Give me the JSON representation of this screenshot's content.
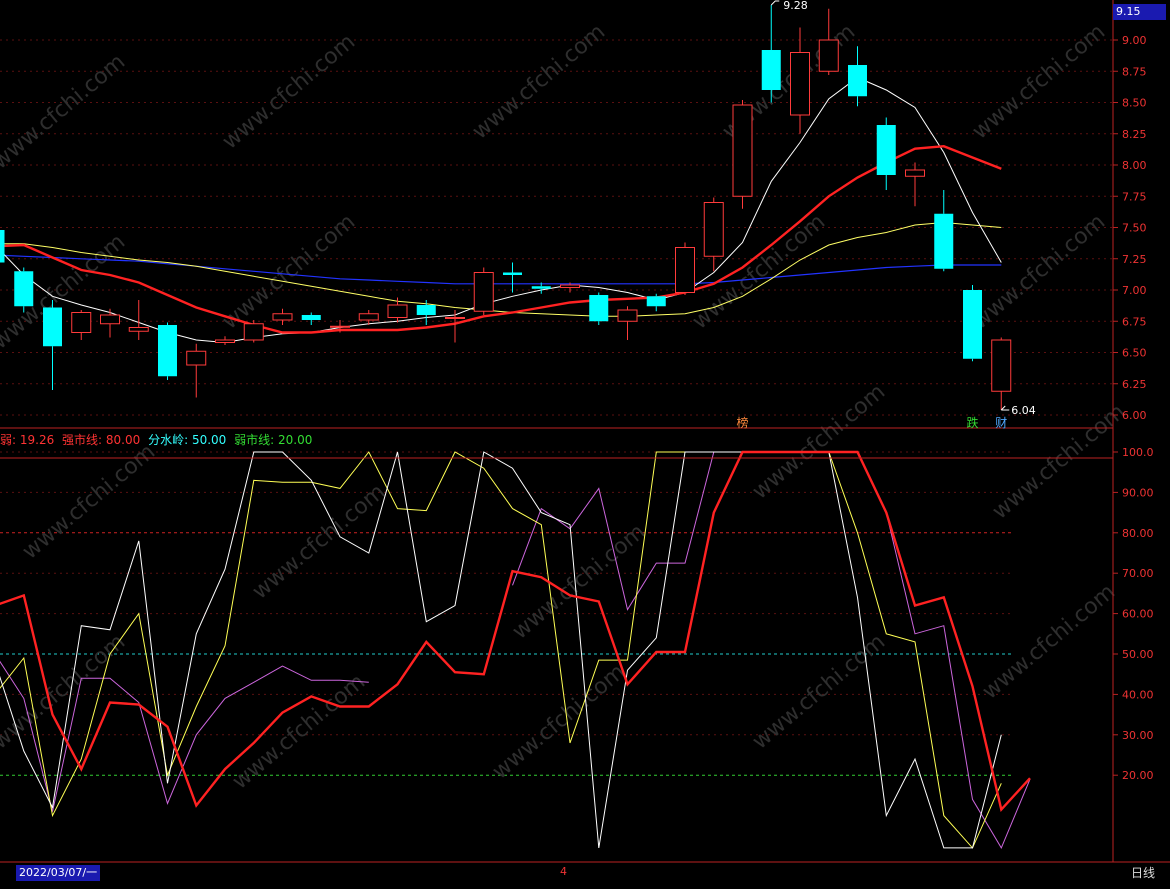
{
  "price_panel": {
    "current_price": "9.15",
    "high_label": "9.28",
    "low_label": "6.04",
    "y_axis_labels": [
      "9.00",
      "8.75",
      "8.50",
      "8.25",
      "8.00",
      "7.75",
      "7.50",
      "7.25",
      "7.00",
      "6.75",
      "6.50",
      "6.25",
      "6.00"
    ],
    "markers": [
      {
        "text": "榜",
        "color": "#ff8a3d"
      },
      {
        "text": "跌",
        "color": "#33dd33"
      },
      {
        "text": "财",
        "color": "#4fa8ff"
      }
    ]
  },
  "indicator_panel": {
    "legend": [
      {
        "text": "弱: 19.26",
        "color": "#ff3333"
      },
      {
        "text": "强市线: 80.00",
        "color": "#ff3333"
      },
      {
        "text": "分水岭: 50.00",
        "color": "#33ffff"
      },
      {
        "text": "弱市线: 20.00",
        "color": "#33dd33"
      }
    ],
    "y_axis_labels": [
      "100.0",
      "90.00",
      "80.00",
      "70.00",
      "60.00",
      "50.00",
      "40.00",
      "30.00",
      "20.00"
    ]
  },
  "footer": {
    "date": "2022/03/07/一",
    "tick_marker": "4",
    "period": "日线"
  },
  "watermark": "www.cfchi.com",
  "chart_data": {
    "type": "candlestick",
    "candles": [
      {
        "o": 7.48,
        "c": 7.22,
        "h": 7.52,
        "l": 7.2
      },
      {
        "o": 7.15,
        "c": 6.87,
        "h": 7.18,
        "l": 6.82
      },
      {
        "o": 6.86,
        "c": 6.55,
        "h": 6.92,
        "l": 6.2
      },
      {
        "o": 6.66,
        "c": 6.82,
        "h": 6.84,
        "l": 6.6
      },
      {
        "o": 6.73,
        "c": 6.8,
        "h": 6.85,
        "l": 6.62
      },
      {
        "o": 6.67,
        "c": 6.7,
        "h": 6.92,
        "l": 6.6
      },
      {
        "o": 6.72,
        "c": 6.31,
        "h": 6.74,
        "l": 6.28
      },
      {
        "o": 6.4,
        "c": 6.51,
        "h": 6.57,
        "l": 6.14
      },
      {
        "o": 6.58,
        "c": 6.6,
        "h": 6.63,
        "l": 6.56
      },
      {
        "o": 6.6,
        "c": 6.73,
        "h": 6.76,
        "l": 6.58
      },
      {
        "o": 6.76,
        "c": 6.81,
        "h": 6.85,
        "l": 6.72
      },
      {
        "o": 6.8,
        "c": 6.76,
        "h": 6.82,
        "l": 6.72
      },
      {
        "o": 6.71,
        "c": 6.71,
        "h": 6.76,
        "l": 6.66
      },
      {
        "o": 6.76,
        "c": 6.81,
        "h": 6.84,
        "l": 6.72
      },
      {
        "o": 6.78,
        "c": 6.88,
        "h": 6.94,
        "l": 6.74
      },
      {
        "o": 6.88,
        "c": 6.8,
        "h": 6.92,
        "l": 6.72
      },
      {
        "o": 6.78,
        "c": 6.78,
        "h": 6.84,
        "l": 6.58
      },
      {
        "o": 6.83,
        "c": 7.14,
        "h": 7.18,
        "l": 6.8
      },
      {
        "o": 7.14,
        "c": 7.12,
        "h": 7.22,
        "l": 6.98
      },
      {
        "o": 7.03,
        "c": 7.01,
        "h": 7.06,
        "l": 6.97
      },
      {
        "o": 7.02,
        "c": 7.04,
        "h": 7.06,
        "l": 6.98
      },
      {
        "o": 6.96,
        "c": 6.75,
        "h": 6.98,
        "l": 6.72
      },
      {
        "o": 6.75,
        "c": 6.84,
        "h": 6.87,
        "l": 6.6
      },
      {
        "o": 6.95,
        "c": 6.87,
        "h": 6.97,
        "l": 6.83
      },
      {
        "o": 6.98,
        "c": 7.34,
        "h": 7.38,
        "l": 6.96
      },
      {
        "o": 7.27,
        "c": 7.7,
        "h": 7.74,
        "l": 7.15
      },
      {
        "o": 7.75,
        "c": 8.48,
        "h": 8.52,
        "l": 7.65
      },
      {
        "o": 8.92,
        "c": 8.6,
        "h": 9.28,
        "l": 8.5
      },
      {
        "o": 8.4,
        "c": 8.9,
        "h": 9.1,
        "l": 8.25
      },
      {
        "o": 8.75,
        "c": 9.0,
        "h": 9.25,
        "l": 8.72
      },
      {
        "o": 8.8,
        "c": 8.55,
        "h": 8.95,
        "l": 8.47
      },
      {
        "o": 8.32,
        "c": 7.92,
        "h": 8.38,
        "l": 7.8
      },
      {
        "o": 7.91,
        "c": 7.96,
        "h": 8.02,
        "l": 7.67
      },
      {
        "o": 7.61,
        "c": 7.17,
        "h": 7.8,
        "l": 7.15
      },
      {
        "o": 7.0,
        "c": 6.45,
        "h": 7.04,
        "l": 6.43
      },
      {
        "o": 6.19,
        "c": 6.6,
        "h": 6.62,
        "l": 6.04
      }
    ],
    "ma_white": [
      7.36,
      7.12,
      6.95,
      6.88,
      6.82,
      6.74,
      6.66,
      6.6,
      6.58,
      6.62,
      6.65,
      6.66,
      6.7,
      6.73,
      6.75,
      6.78,
      6.8,
      6.89,
      6.95,
      7.0,
      7.04,
      7.02,
      6.98,
      6.92,
      6.98,
      7.14,
      7.38,
      7.87,
      8.18,
      8.53,
      8.7,
      8.6,
      8.46,
      8.1,
      7.62,
      7.22
    ],
    "ma_red": [
      7.35,
      7.36,
      7.26,
      7.16,
      7.12,
      7.06,
      6.96,
      6.86,
      6.79,
      6.72,
      6.66,
      6.66,
      6.68,
      6.68,
      6.68,
      6.7,
      6.73,
      6.79,
      6.82,
      6.86,
      6.9,
      6.92,
      6.93,
      6.94,
      6.98,
      7.05,
      7.18,
      7.36,
      7.55,
      7.75,
      7.9,
      8.02,
      8.13,
      8.15,
      8.06,
      7.97
    ],
    "ma_yellow": [
      7.37,
      7.37,
      7.34,
      7.3,
      7.27,
      7.24,
      7.22,
      7.19,
      7.15,
      7.11,
      7.07,
      7.03,
      6.99,
      6.95,
      6.91,
      6.89,
      6.86,
      6.84,
      6.82,
      6.81,
      6.8,
      6.79,
      6.79,
      6.8,
      6.81,
      6.86,
      6.95,
      7.09,
      7.24,
      7.36,
      7.42,
      7.46,
      7.52,
      7.54,
      7.52,
      7.5
    ],
    "ma_blue": [
      7.28,
      7.27,
      7.26,
      7.25,
      7.24,
      7.23,
      7.21,
      7.19,
      7.17,
      7.15,
      7.13,
      7.11,
      7.09,
      7.08,
      7.07,
      7.06,
      7.05,
      7.05,
      7.05,
      7.05,
      7.05,
      7.05,
      7.05,
      7.05,
      7.05,
      7.06,
      7.08,
      7.1,
      7.12,
      7.14,
      7.16,
      7.18,
      7.19,
      7.2,
      7.2,
      7.2
    ],
    "osc_red": [
      62,
      64.5,
      35,
      21.5,
      38,
      37.5,
      32,
      12.5,
      21.5,
      28,
      35.5,
      39.5,
      37,
      37,
      42.5,
      53,
      45.5,
      45,
      70.5,
      69,
      64.5,
      63,
      42.5,
      50.5,
      50.5,
      85,
      100,
      100,
      100,
      100,
      100,
      85,
      62,
      64,
      42,
      11.5,
      19.26
    ],
    "osc_white": [
      48,
      26,
      12,
      57,
      56,
      78,
      18,
      55,
      71,
      100,
      100,
      93,
      79,
      75,
      100,
      58,
      62,
      100,
      96,
      85,
      82,
      2,
      46,
      54,
      100,
      100,
      100,
      100,
      100,
      100,
      64,
      10,
      24,
      2,
      2,
      30
    ],
    "osc_yellow": [
      40,
      49,
      10,
      24,
      50,
      60,
      20,
      37,
      52,
      93,
      92.5,
      92.5,
      91,
      100,
      86,
      85.5,
      100,
      96,
      86,
      82,
      28,
      48.5,
      48.5,
      100,
      100,
      100,
      100,
      100,
      100,
      100,
      80,
      55,
      53,
      10,
      2,
      18
    ],
    "osc_magenta": [
      50,
      39,
      11,
      44,
      44,
      38,
      13,
      30,
      39,
      43,
      47,
      43.5,
      43.5,
      43,
      null,
      null,
      null,
      null,
      67,
      86,
      81,
      91,
      61,
      72.5,
      72.5,
      100,
      100,
      100,
      100,
      100,
      100,
      85,
      55,
      57,
      14,
      2,
      19
    ],
    "reference_lines": {
      "strong": 80,
      "divide": 50,
      "weak": 20
    }
  }
}
